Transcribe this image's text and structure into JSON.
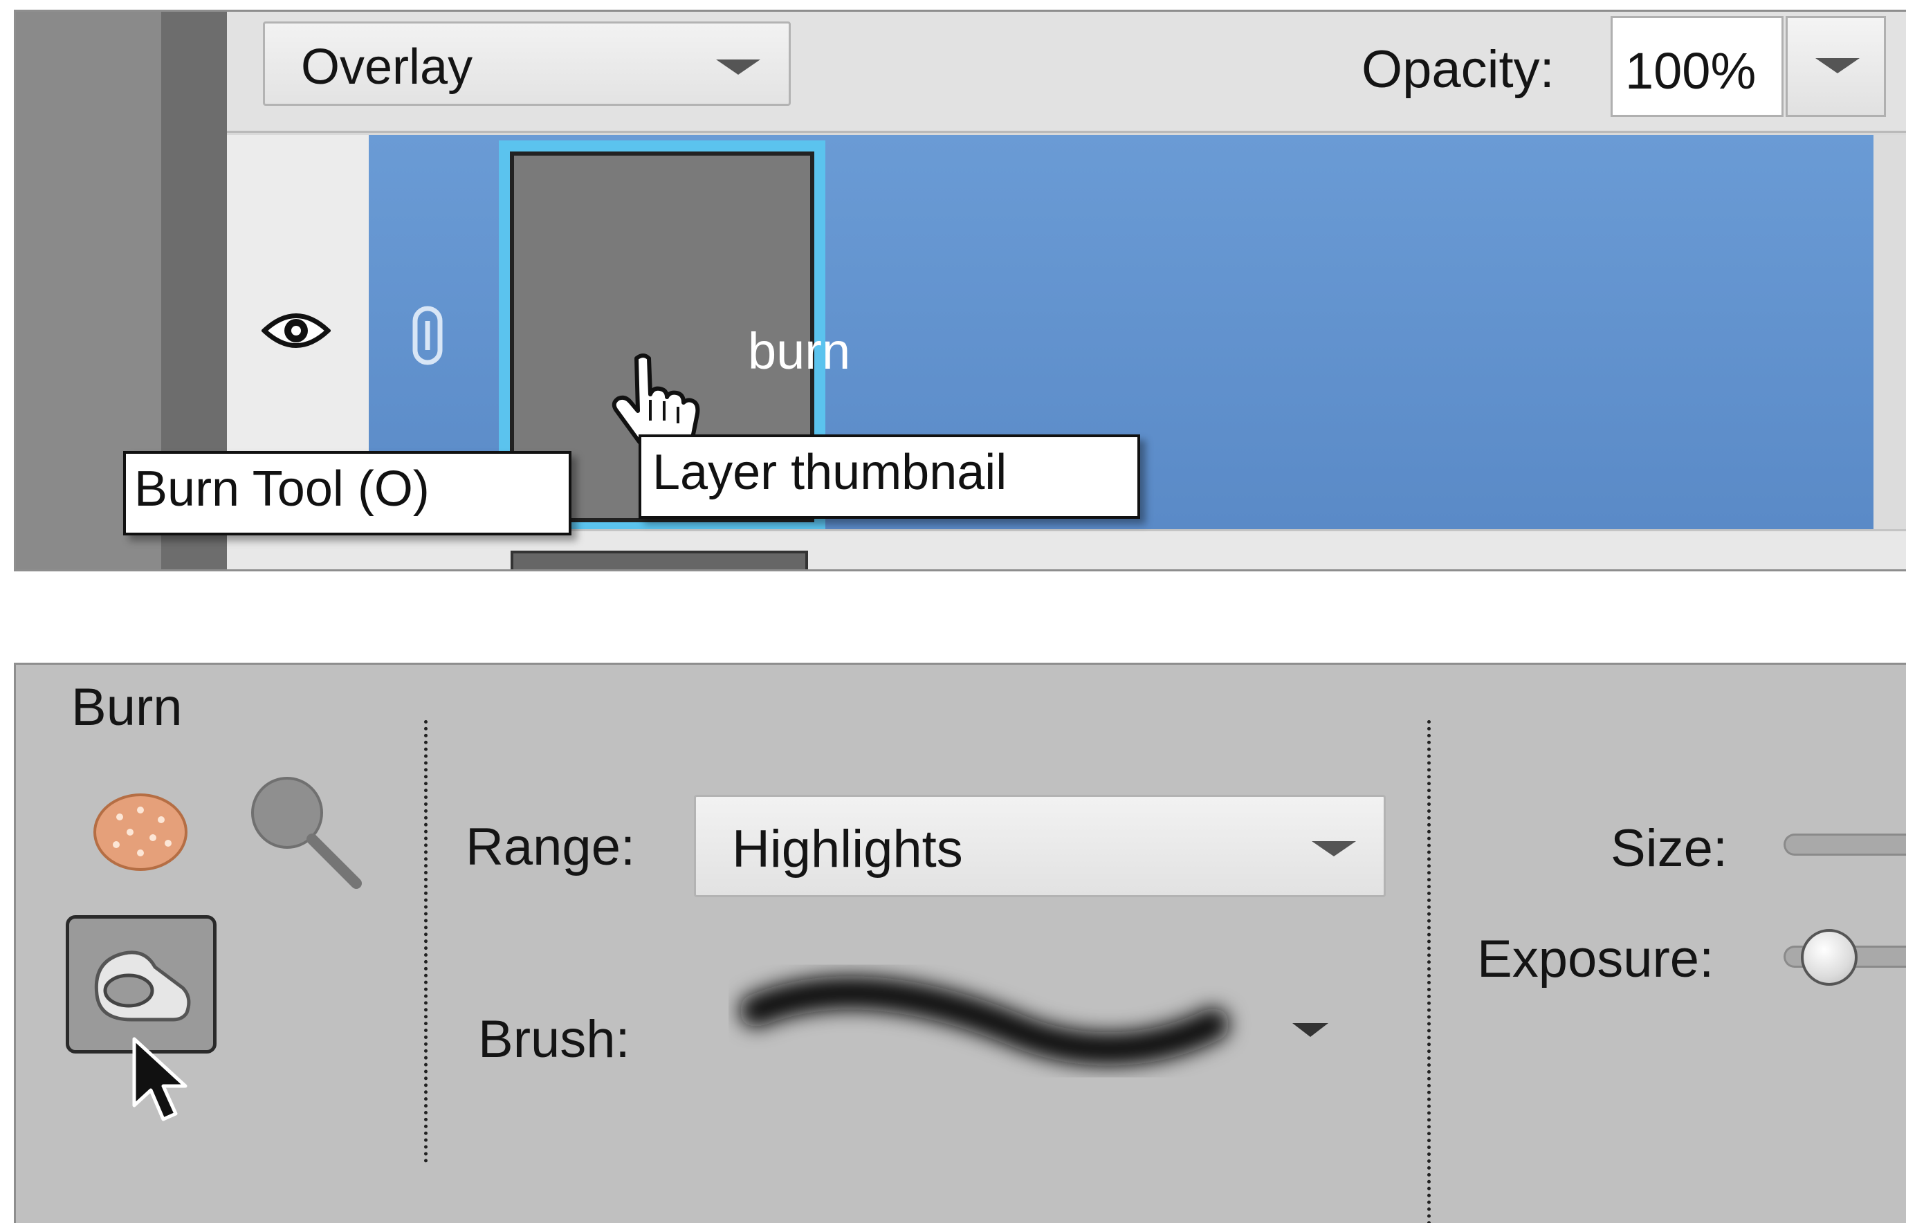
{
  "layers_panel": {
    "blend_mode": "Overlay",
    "opacity_label": "Opacity:",
    "opacity_value": "100%",
    "layer": {
      "name": "burn",
      "visible": true,
      "selected": true,
      "selection_color": "#6a9bd5"
    },
    "thumbnail_tooltip": "Layer thumbnail"
  },
  "tool_options": {
    "tool_name": "Burn",
    "tools": [
      {
        "name": "sponge-icon",
        "active": false
      },
      {
        "name": "dodge-icon",
        "active": false
      },
      {
        "name": "burn-icon",
        "active": true
      }
    ],
    "burn_tooltip": "Burn Tool (O)",
    "range_label": "Range:",
    "range_value": "Highlights",
    "brush_label": "Brush:",
    "size_label": "Size:",
    "exposure_label": "Exposure:"
  },
  "icons": {
    "visibility": "eye-icon",
    "link": "link-icon",
    "hand_cursor": "hand-cursor-icon",
    "arrow_cursor": "arrow-cursor-icon"
  }
}
